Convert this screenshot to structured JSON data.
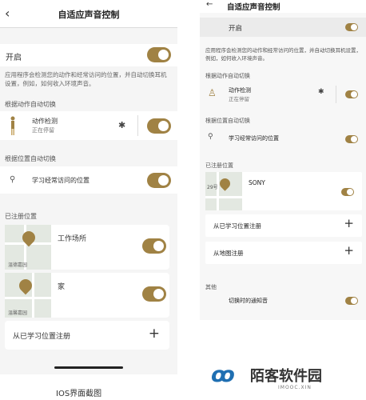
{
  "left": {
    "header": {
      "back_icon": "chevron-left",
      "title": "自适应声音控制"
    },
    "enable": {
      "label": "开启",
      "on": true
    },
    "description": "应用程序会检测您的动作和经常访问的位置，并自动切换耳机设置，例如，如何收入环境声音。",
    "motion_section": {
      "title": "根据动作自动切换",
      "item_title": "动作检测",
      "item_status": "正在停留",
      "on": true
    },
    "location_section": {
      "title": "根据位置自动切换",
      "item_title": "学习经常访问的位置",
      "on": true
    },
    "registered_section": {
      "title": "已注册位置",
      "places": [
        {
          "name": "工作场所",
          "map_label": "温德嘉园",
          "on": true
        },
        {
          "name": "家",
          "map_label": "温馨嘉园",
          "on": true
        }
      ]
    },
    "register_from_learned": "从已学习位置注册",
    "caption": "IOS界面截图"
  },
  "right": {
    "header": {
      "back_icon": "arrow-left",
      "title": "自适应声音控制"
    },
    "enable": {
      "label": "开启",
      "on": true
    },
    "description": "应用程序会检测您的动作和经常访问的位置，并自动切换耳机设置，例如，如何收入环境声音。",
    "motion_section": {
      "title": "根据动作自动切换",
      "item_title": "动作检测",
      "item_status": "正在停留",
      "on": true
    },
    "location_section": {
      "title": "根据位置自动切换",
      "item_title": "学习经常访问的位置",
      "on": true
    },
    "registered_section": {
      "title": "已注册位置",
      "place_name": "SONY",
      "map_label": "29号",
      "on": true
    },
    "register_from_learned": "从已学习位置注册",
    "register_from_map": "从地图注册",
    "other_section": {
      "title": "其他",
      "item_title": "切换时的通知音",
      "on": true
    }
  },
  "watermark": {
    "text": "陌客软件园",
    "sub": "IMOOC.XIN"
  },
  "colors": {
    "accent": "#a08244",
    "background": "#f5f5f5",
    "card": "#ffffff"
  }
}
